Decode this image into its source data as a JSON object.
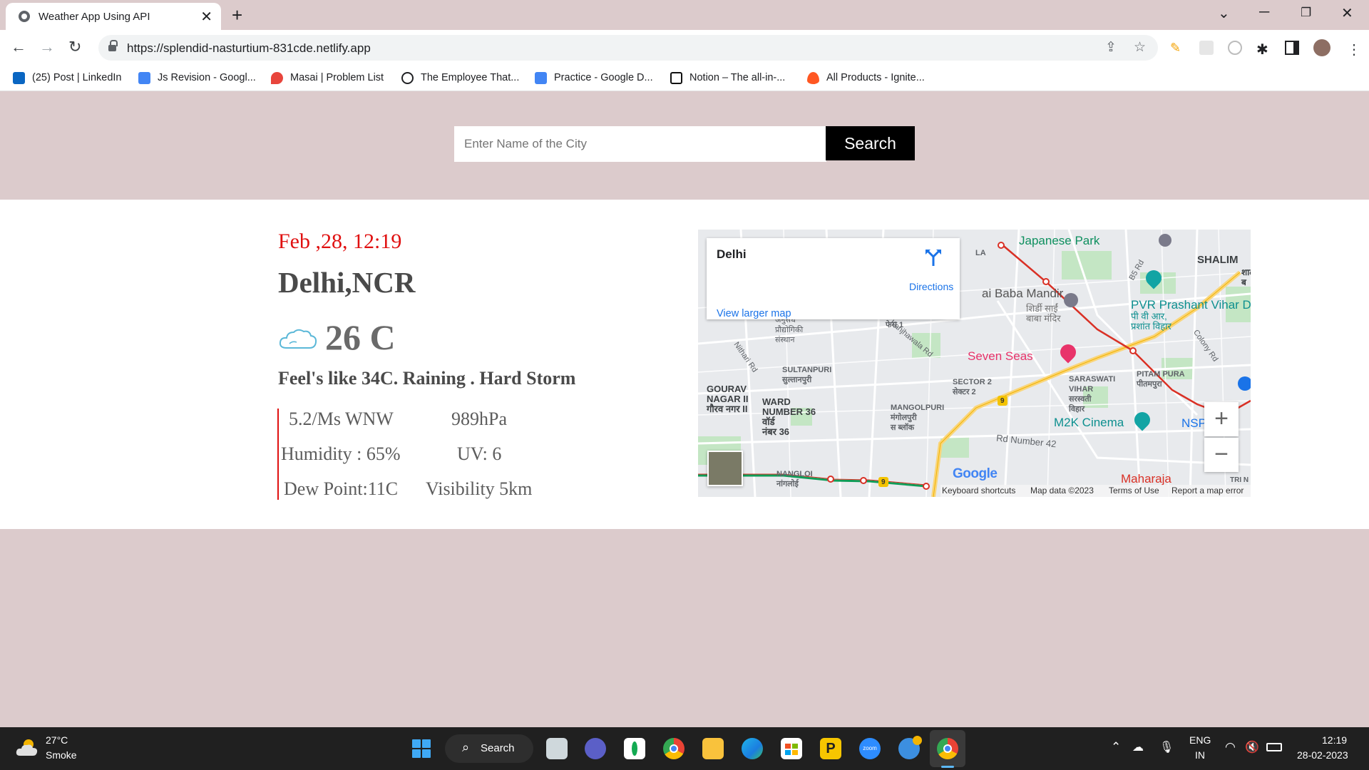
{
  "browser": {
    "tab_title": "Weather App Using API",
    "url": "https://splendid-nasturtium-831cde.netlify.app",
    "bookmarks": [
      {
        "label": "(25) Post | LinkedIn",
        "icon": "linkedin-icon"
      },
      {
        "label": "Js Revision - Googl...",
        "icon": "google-docs-icon"
      },
      {
        "label": "Masai | Problem List",
        "icon": "masai-icon"
      },
      {
        "label": "The Employee That...",
        "icon": "article-icon"
      },
      {
        "label": "Practice - Google D...",
        "icon": "google-docs-icon"
      },
      {
        "label": "Notion – The all-in-...",
        "icon": "notion-icon"
      },
      {
        "label": "All Products - Ignite...",
        "icon": "fire-icon"
      }
    ]
  },
  "search": {
    "placeholder": "Enter Name of the City",
    "button_label": "Search"
  },
  "weather": {
    "datetime": "Feb ,28, 12:19",
    "city": "Delhi,NCR",
    "temperature": "26 C",
    "feels_like": "Feel's like 34C. Raining . Hard Storm",
    "wind": "5.2/Ms WNW",
    "pressure": "989hPa",
    "humidity": "Humidity : 65%",
    "uv": "UV: 6",
    "dew_point": "Dew Point:11C",
    "visibility": "Visibility 5km"
  },
  "map": {
    "place_name": "Delhi",
    "directions_label": "Directions",
    "view_larger_label": "View larger map",
    "zoom_in": "+",
    "zoom_out": "−",
    "logo": "Google",
    "attribution": {
      "shortcuts": "Keyboard shortcuts",
      "data": "Map data ©2023",
      "terms": "Terms of Use",
      "report": "Report a map error"
    },
    "labels": {
      "japanese_park": "Japanese Park",
      "shalimar": "SHALIM",
      "sai_baba": "ai Baba Mandir",
      "sai_baba_hi": "शिर्डी साईं\nबाबा मंदिर",
      "pvr": "PVR Prashant Vihar D",
      "pvr_hi": "पी वी आर,\nप्रशांत विहार",
      "seven_seas": "Seven Seas",
      "sultanpuri": "SULTANPURI\nसुल्तानपुरी",
      "gourav_nagar": "GOURAV\nNAGAR II\nगौरव नगर II",
      "ward36": "WARD\nNUMBER 36\nवॉर्ड\nनंबर 36",
      "mangolpuri": "MANGOLPURI\nमंगोलपुरी\nस ब्लॉक",
      "sector2": "SECTOR 2\nसेक्टर 2",
      "saraswati": "SARASWATI\nVIHAR\nसरस्वती\nविहार",
      "pitampura": "PITAM PURA\nपीतमपुरा",
      "m2k": "M2K Cinema",
      "nsp": "NSP",
      "nangloi": "NANGLOI\nनांगलोई",
      "maharaja": "Maharaja",
      "rd42": "Rd Number 42",
      "kanjhawala": "Kanjhawala Rd",
      "nithari": "Nithari Rd",
      "colony": "Colony Rd",
      "b5": "B5 Rd",
      "road_9": "9",
      "institute_hi": "अनुसंध\nप्रौद्योगिकी\nसंस्थान",
      "phase1": "फेस 1",
      "la": "LA",
      "tri_n": "TRI N",
      "shalim_hi": "शाल\nब"
    }
  },
  "taskbar": {
    "weather_temp": "27°C",
    "weather_condition": "Smoke",
    "search_label": "Search",
    "language": "ENG",
    "region": "IN",
    "time": "12:19",
    "date": "28-02-2023"
  },
  "colors": {
    "page_band": "#dccbcc",
    "date_red": "#e01010",
    "link_blue": "#1a73e8",
    "metro_red": "#d93025",
    "metro_green": "#0f9d58"
  }
}
